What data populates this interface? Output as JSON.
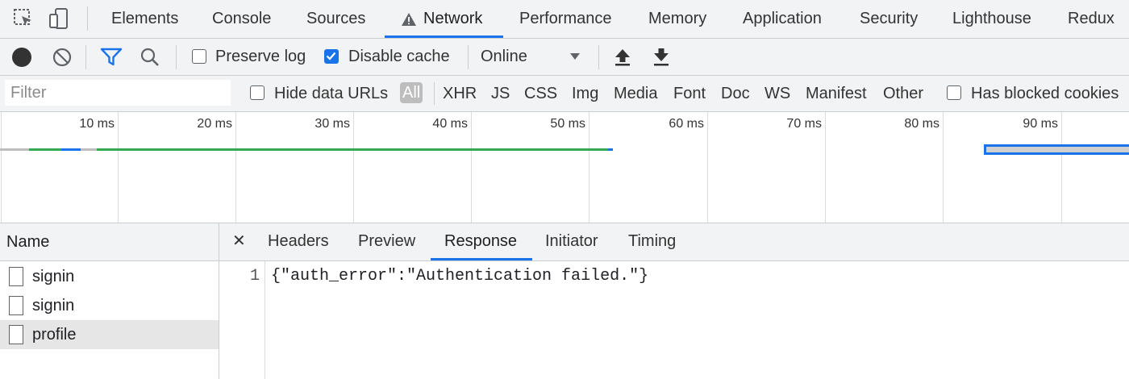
{
  "tabs": {
    "items": [
      "Elements",
      "Console",
      "Sources",
      "Network",
      "Performance",
      "Memory",
      "Application",
      "Security",
      "Lighthouse",
      "Redux"
    ],
    "active": "Network"
  },
  "toolbar": {
    "preserve_log_label": "Preserve log",
    "preserve_log_checked": false,
    "disable_cache_label": "Disable cache",
    "disable_cache_checked": true,
    "throttling_value": "Online"
  },
  "filter": {
    "placeholder": "Filter",
    "hide_data_urls_label": "Hide data URLs",
    "types": [
      "All",
      "XHR",
      "JS",
      "CSS",
      "Img",
      "Media",
      "Font",
      "Doc",
      "WS",
      "Manifest",
      "Other"
    ],
    "active_type": "All",
    "has_blocked_cookies_label": "Has blocked cookies"
  },
  "overview": {
    "ticks": [
      "10 ms",
      "20 ms",
      "30 ms",
      "40 ms",
      "50 ms",
      "60 ms",
      "70 ms",
      "80 ms",
      "90 ms"
    ]
  },
  "requests": {
    "header": "Name",
    "items": [
      {
        "name": "signin",
        "selected": false
      },
      {
        "name": "signin",
        "selected": false
      },
      {
        "name": "profile",
        "selected": true
      }
    ]
  },
  "details": {
    "close_glyph": "✕",
    "tabs": [
      "Headers",
      "Preview",
      "Response",
      "Initiator",
      "Timing"
    ],
    "active_tab": "Response",
    "response": {
      "line_number": "1",
      "body": "{\"auth_error\":\"Authentication failed.\"}"
    }
  },
  "colors": {
    "accent": "#1a73e8",
    "waterfall_green": "#34a853",
    "toolbar_bg": "#f1f3f4"
  }
}
